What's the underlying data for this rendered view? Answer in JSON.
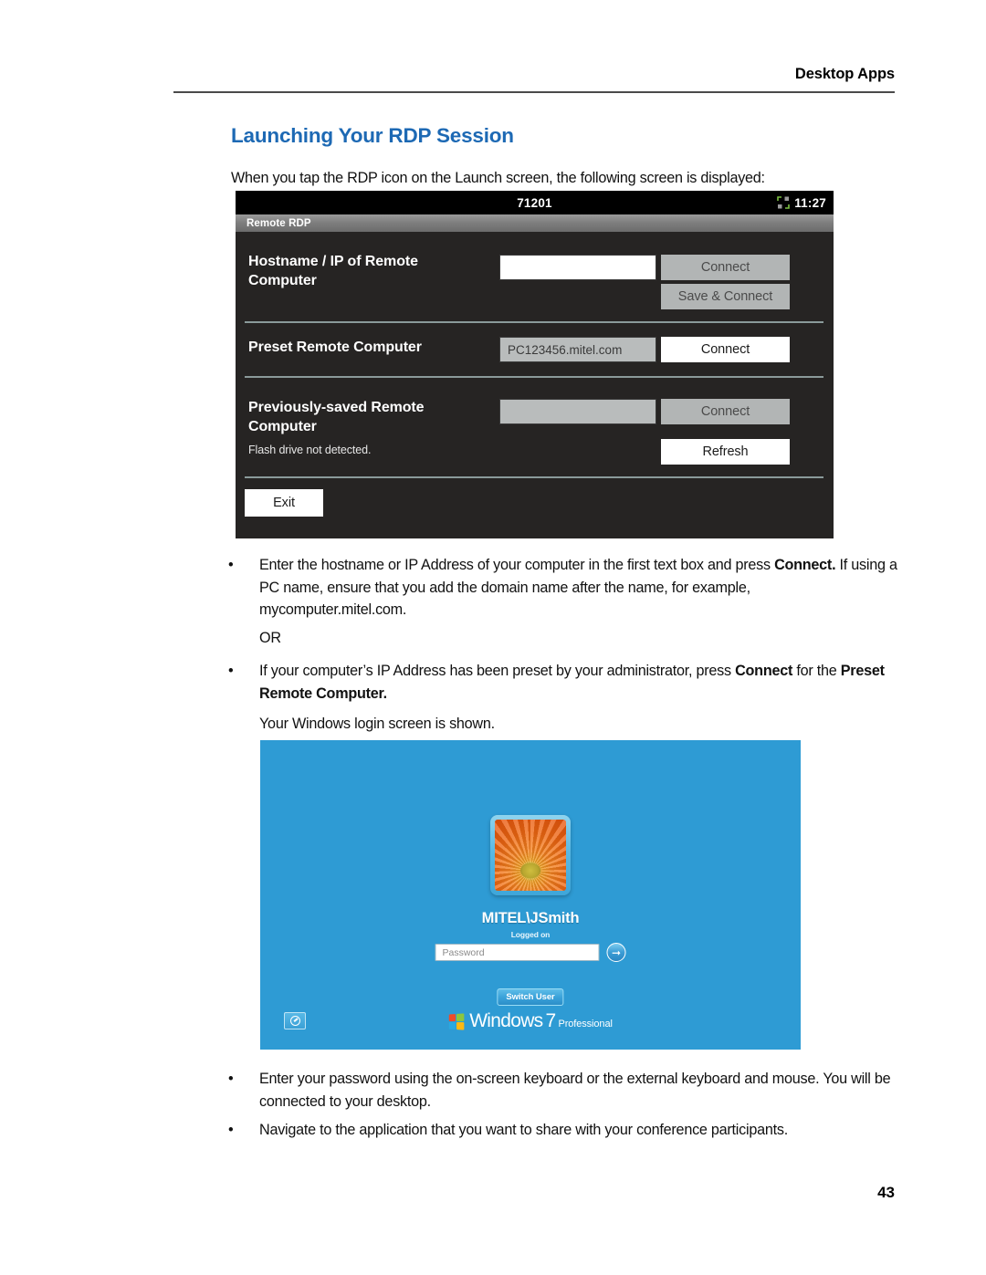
{
  "header": {
    "title": "Desktop Apps"
  },
  "section": {
    "title": "Launching Your RDP Session",
    "intro": "When you tap the RDP icon on the Launch screen, the following screen is displayed:"
  },
  "rdp_screen": {
    "status_bar": {
      "extension": "71201",
      "time": "11:27",
      "network_icon": "network-connected-icon"
    },
    "app_title": "Remote RDP",
    "rows": [
      {
        "label": "Hostname / IP of Remote Computer",
        "input_value": "",
        "input_state": "blank",
        "buttons": [
          {
            "label": "Connect",
            "state": "disabled"
          },
          {
            "label": "Save & Connect",
            "state": "disabled"
          }
        ]
      },
      {
        "label": "Preset Remote Computer",
        "input_value": "PC123456.mitel.com",
        "input_state": "filled",
        "buttons": [
          {
            "label": "Connect",
            "state": "enabled"
          }
        ]
      },
      {
        "label": "Previously-saved Remote Computer",
        "input_value": "",
        "input_state": "disabled",
        "note": "Flash drive not detected.",
        "buttons": [
          {
            "label": "Connect",
            "state": "disabled"
          },
          {
            "label": "Refresh",
            "state": "enabled"
          }
        ]
      }
    ],
    "exit_button": "Exit"
  },
  "bullets": {
    "b1_part1": "Enter the hostname or IP Address of your computer in the first text box and press ",
    "b1_bold1": "Connect.",
    "b1_part2": " If using a PC name, ensure that you add the domain name after the name, for example, mycomputer.mitel.com.",
    "or": "OR",
    "b2_part1": "If your computer’s IP Address has been preset by your administrator, press ",
    "b2_bold1": "Connect",
    "b2_part2": " for the ",
    "b2_bold2": "Preset Remote Computer.",
    "shown": "Your Windows login screen is shown.",
    "b3": "Enter your password using the on-screen keyboard or the external keyboard and mouse. You will be connected to your desktop.",
    "b4": "Navigate to the application that you want to share with your conference participants.",
    "marker": "•"
  },
  "windows_login": {
    "username": "MITEL\\JSmith",
    "logged_on": "Logged on",
    "password_placeholder": "Password",
    "submit_icon": "arrow-right-icon",
    "switch_user": "Switch User",
    "ease_of_access_icon": "ease-of-access-icon",
    "brand_windows": "Windows",
    "brand_version": "7",
    "brand_edition": "Professional",
    "avatar_icon": "user-avatar-flower"
  },
  "footer": {
    "page_number": "43"
  },
  "colors": {
    "heading_blue": "#1d69b4",
    "login_background": "#2e9bd4",
    "device_background": "#262423"
  }
}
